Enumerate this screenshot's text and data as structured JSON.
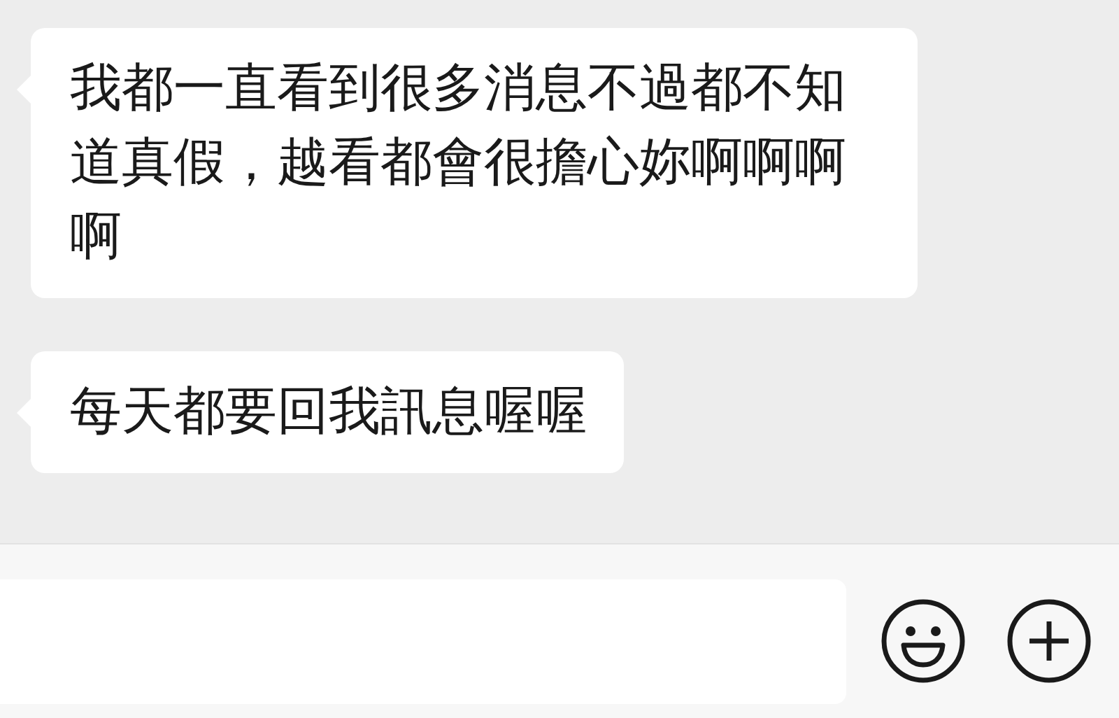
{
  "messages": [
    {
      "text": "我都一直看到很多消息不過都不知道真假，越看都會很擔心妳啊啊啊啊"
    },
    {
      "text": "每天都要回我訊息喔喔"
    }
  ]
}
